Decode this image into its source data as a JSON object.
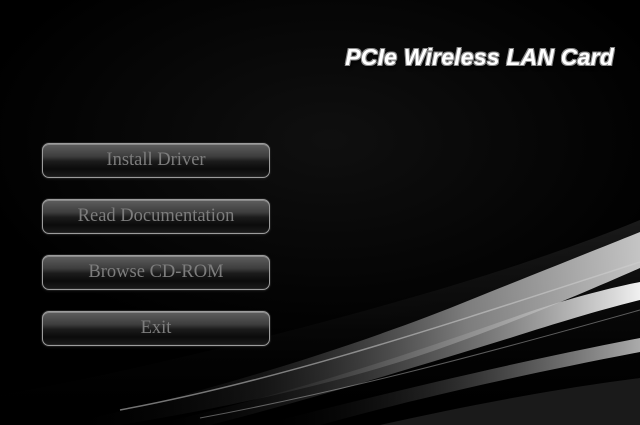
{
  "header": {
    "title": "PCIe Wireless LAN Card"
  },
  "menu": {
    "install_label": "Install Driver",
    "docs_label": "Read Documentation",
    "browse_label": "Browse CD-ROM",
    "exit_label": "Exit"
  },
  "colors": {
    "background": "#000000",
    "button_text": "#7d7d7d",
    "title_text": "#ffffff"
  }
}
